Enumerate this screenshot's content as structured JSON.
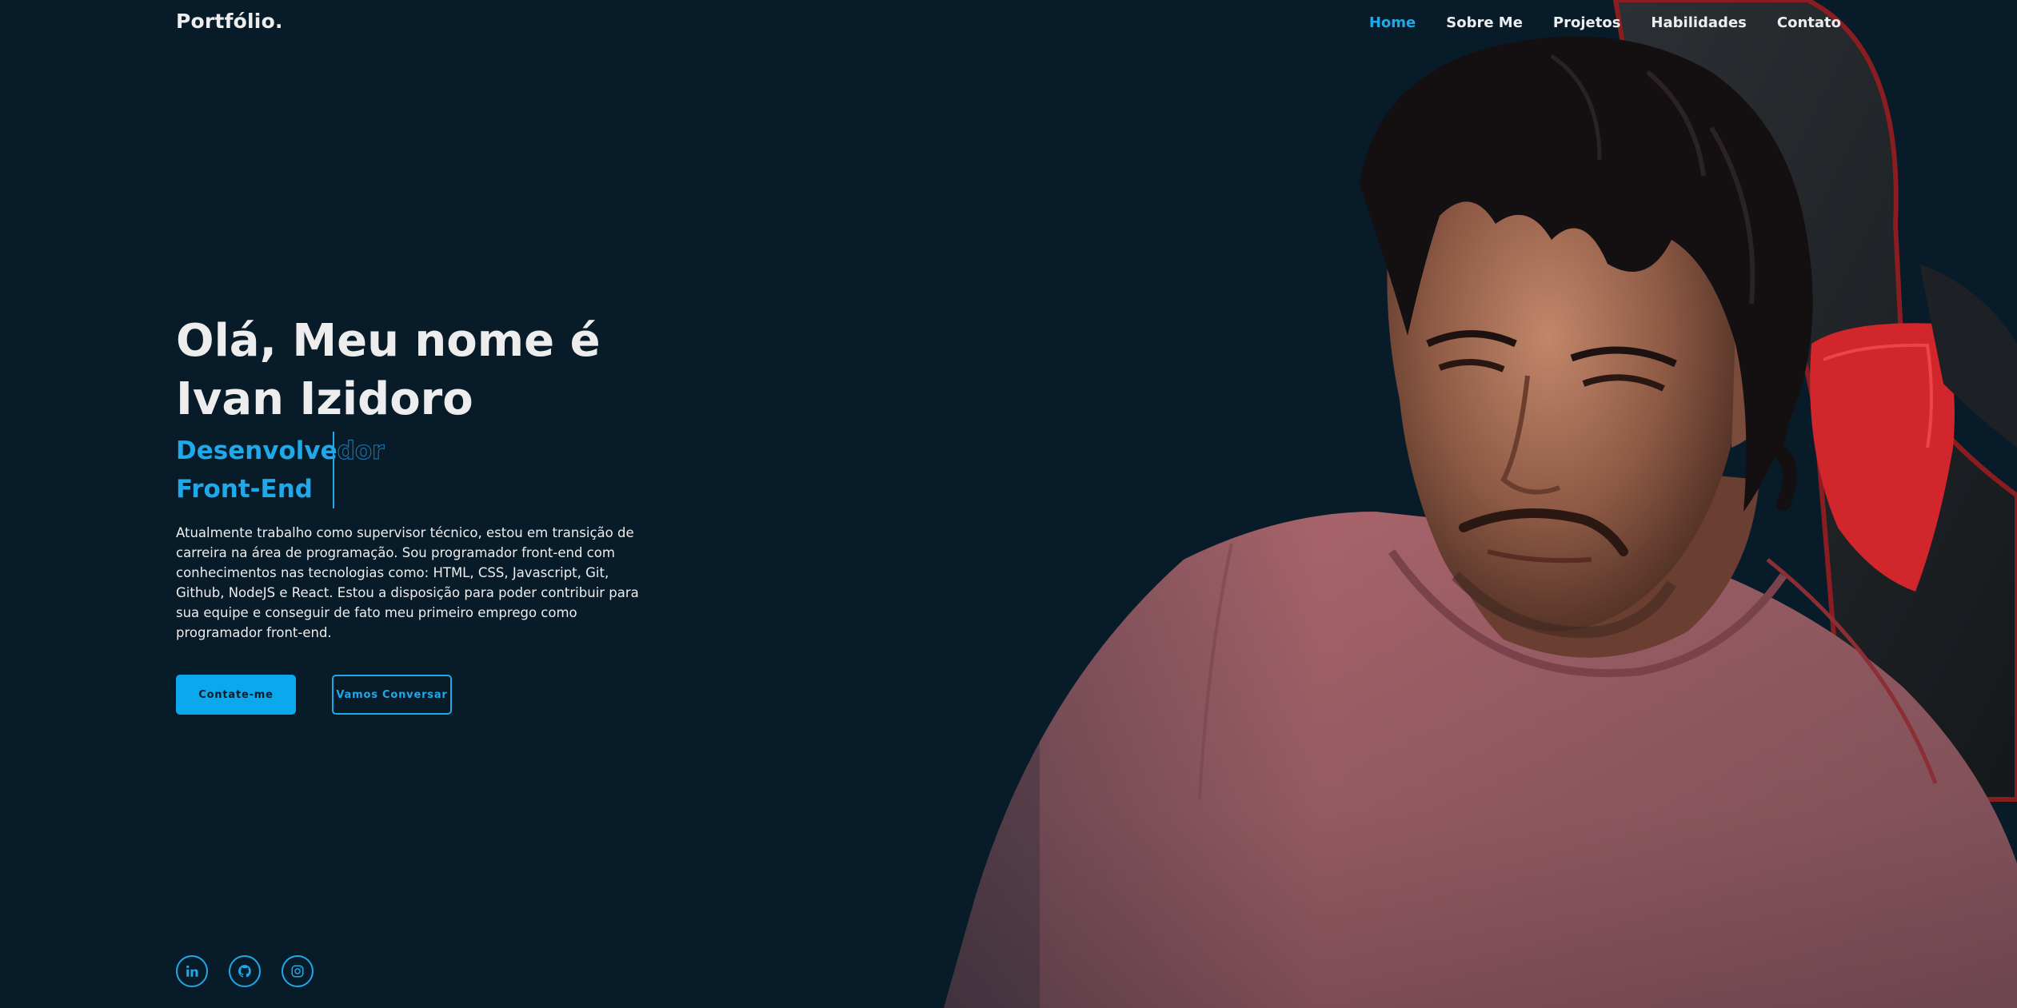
{
  "header": {
    "logo": "Portfólio.",
    "nav": [
      {
        "label": "Home",
        "active": true
      },
      {
        "label": "Sobre Me",
        "active": false
      },
      {
        "label": "Projetos",
        "active": false
      },
      {
        "label": "Habilidades",
        "active": false
      },
      {
        "label": "Contato",
        "active": false
      }
    ]
  },
  "hero": {
    "title_line1": "Olá, Meu nome é",
    "title_line2": "Ivan Izidoro",
    "role_solid": "Desenvolve",
    "role_ghost": "dor",
    "role_line2": "Front-End",
    "bio": "Atualmente trabalho como supervisor técnico, estou em transição de carreira na área de programação. Sou programador front-end com conhecimentos nas tecnologias como: HTML, CSS, Javascript, Git, Github, NodeJS e React. Estou a disposição para poder contribuir para sua equipe e conseguir de fato meu primeiro emprego como programador front-end.",
    "buttons": {
      "primary": "Contate-me",
      "secondary": "Vamos Conversar"
    }
  },
  "social": [
    {
      "icon": "linkedin-icon"
    },
    {
      "icon": "github-icon"
    },
    {
      "icon": "instagram-icon"
    }
  ],
  "colors": {
    "background": "#081b29",
    "accent": "#1da9ea",
    "text": "#ededed"
  }
}
